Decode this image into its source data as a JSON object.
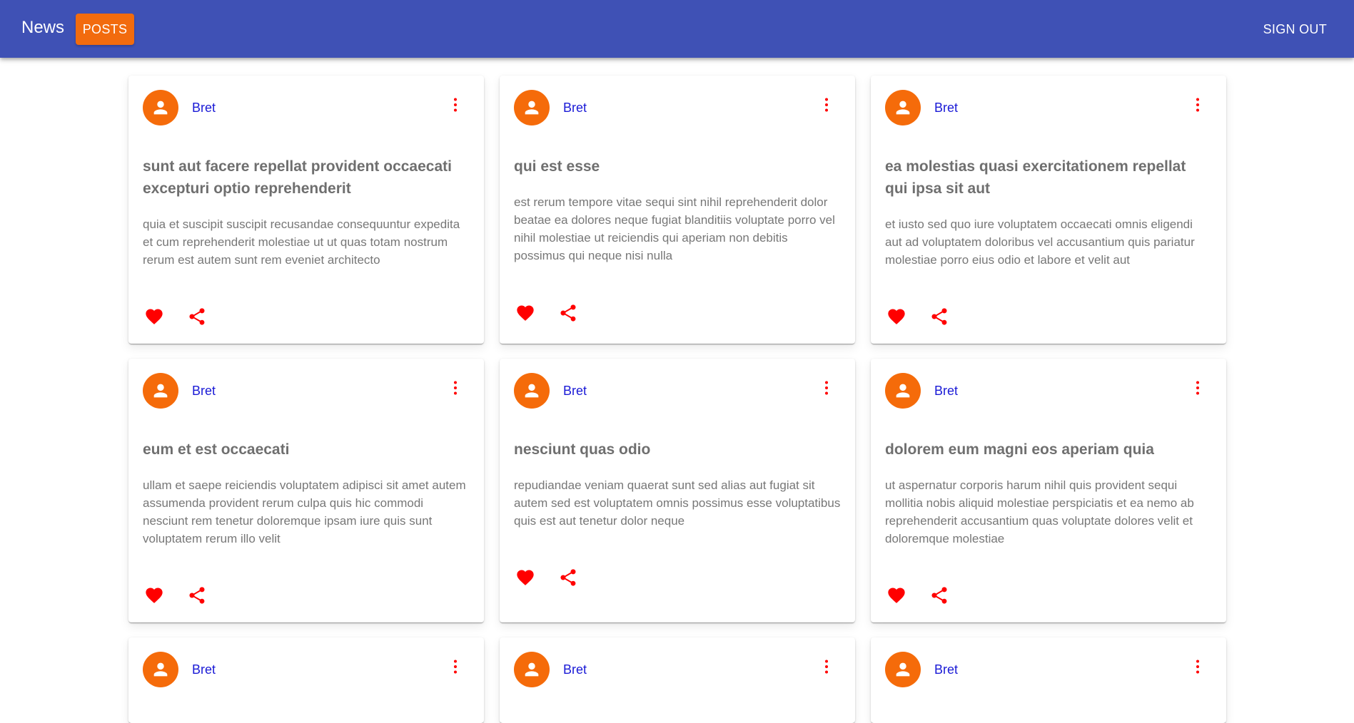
{
  "appbar": {
    "brand": "News",
    "posts_label": "POSTS",
    "signout_label": "SIGN OUT",
    "color": "#3f51b5",
    "accent": "#f26b0e"
  },
  "posts": [
    {
      "author": "Bret",
      "title": "sunt aut facere repellat provident occaecati excepturi optio reprehenderit",
      "body": "quia et suscipit suscipit recusandae consequuntur expedita et cum reprehenderit molestiae ut ut quas totam nostrum rerum est autem sunt rem eveniet architecto"
    },
    {
      "author": "Bret",
      "title": "qui est esse",
      "body": "est rerum tempore vitae sequi sint nihil reprehenderit dolor beatae ea dolores neque fugiat blanditiis voluptate porro vel nihil molestiae ut reiciendis qui aperiam non debitis possimus qui neque nisi nulla"
    },
    {
      "author": "Bret",
      "title": "ea molestias quasi exercitationem repellat qui ipsa sit aut",
      "body": "et iusto sed quo iure voluptatem occaecati omnis eligendi aut ad voluptatem doloribus vel accusantium quis pariatur molestiae porro eius odio et labore et velit aut"
    },
    {
      "author": "Bret",
      "title": "eum et est occaecati",
      "body": "ullam et saepe reiciendis voluptatem adipisci sit amet autem assumenda provident rerum culpa quis hic commodi nesciunt rem tenetur doloremque ipsam iure quis sunt voluptatem rerum illo velit"
    },
    {
      "author": "Bret",
      "title": "nesciunt quas odio",
      "body": "repudiandae veniam quaerat sunt sed alias aut fugiat sit autem sed est voluptatem omnis possimus esse voluptatibus quis est aut tenetur dolor neque"
    },
    {
      "author": "Bret",
      "title": "dolorem eum magni eos aperiam quia",
      "body": "ut aspernatur corporis harum nihil quis provident sequi mollitia nobis aliquid molestiae perspiciatis et ea nemo ab reprehenderit accusantium quas voluptate dolores velit et doloremque molestiae"
    },
    {
      "author": "Bret"
    },
    {
      "author": "Bret"
    },
    {
      "author": "Bret"
    }
  ],
  "icons": {
    "avatar": "person-icon",
    "more": "more-vert-icon",
    "like": "heart-icon",
    "share": "share-icon"
  },
  "colors": {
    "avatar_bg": "#f56b0a",
    "author_text": "#1a1ad6",
    "action_icons": "#ff0000"
  }
}
